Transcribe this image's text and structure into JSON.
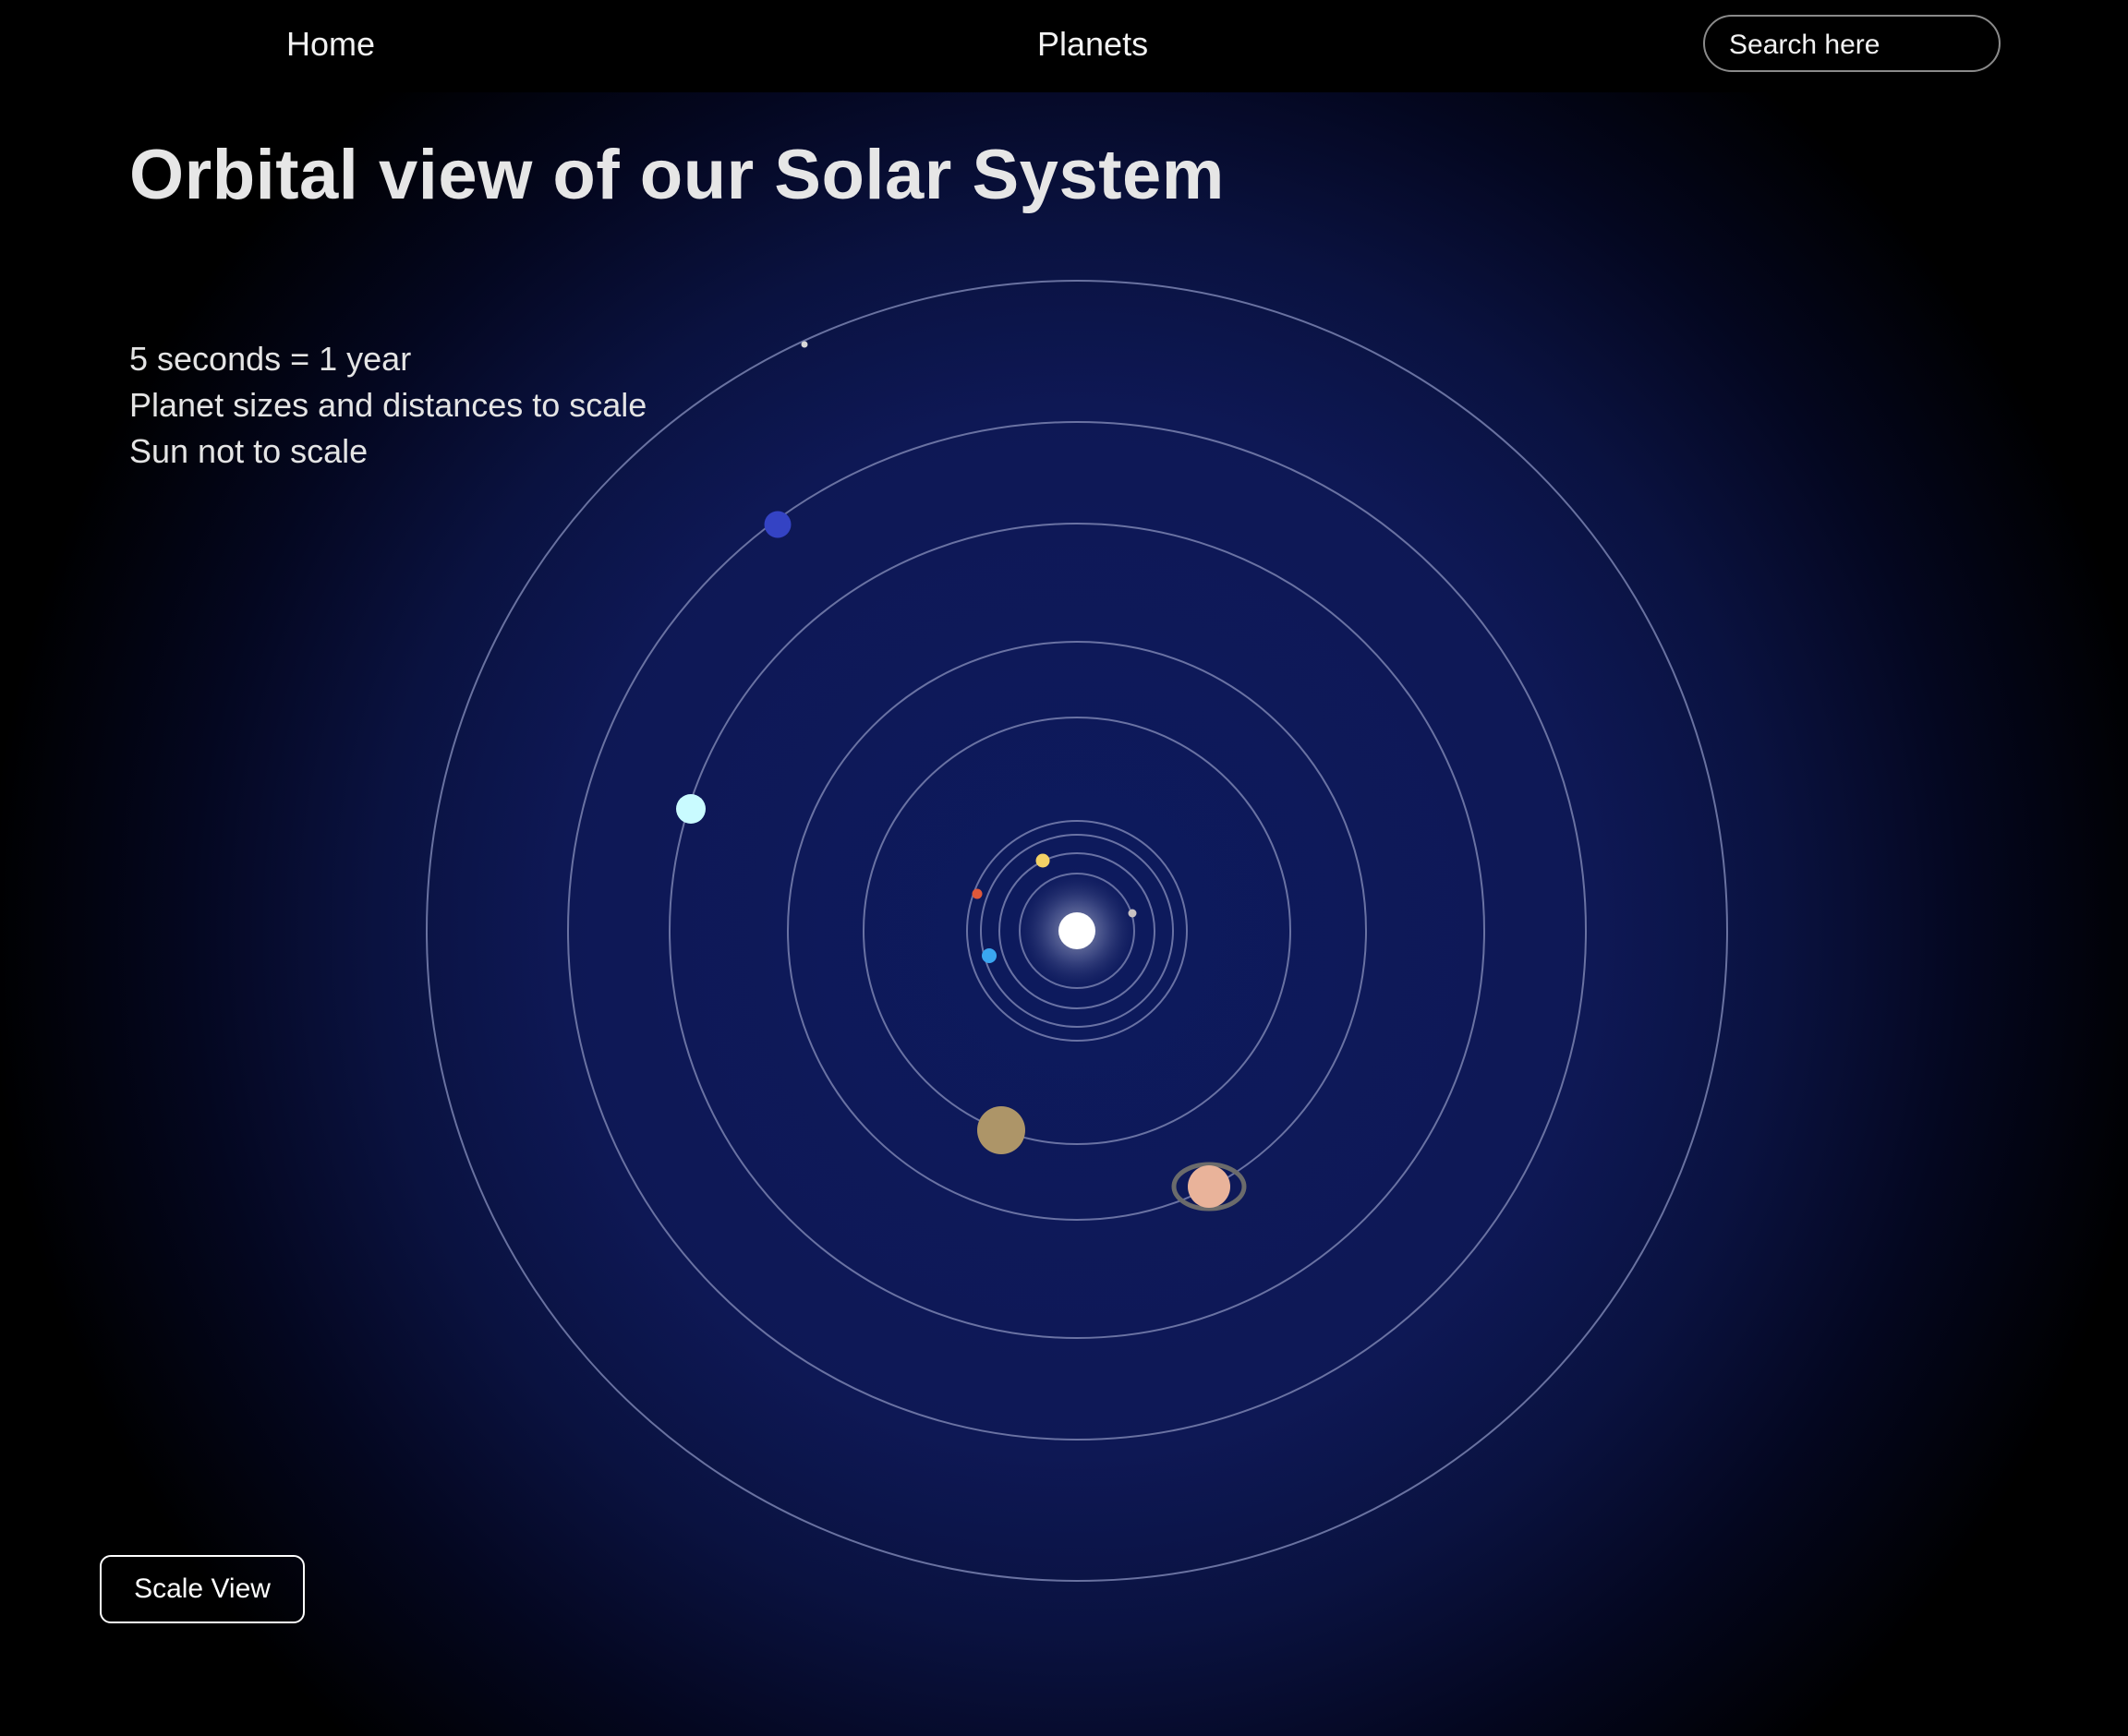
{
  "nav": {
    "home_label": "Home",
    "planets_label": "Planets",
    "search_placeholder": "Search here"
  },
  "page": {
    "title": "Orbital view of our Solar System",
    "notes": [
      "5 seconds = 1 year",
      "Planet sizes and distances to scale",
      "Sun not to scale"
    ]
  },
  "colors": {
    "background": "#000000",
    "space_glow": "#0d1a5e",
    "orbit_line": "#7a82b0",
    "sun": "#ffffff"
  },
  "bodies": {
    "sun": {
      "name": "sun",
      "color": "#ffffff"
    },
    "planets": [
      {
        "name": "mercury",
        "color": "#c9c2c2"
      },
      {
        "name": "venus",
        "color": "#f3d266"
      },
      {
        "name": "earth",
        "color": "#3aa6f0"
      },
      {
        "name": "mars",
        "color": "#e0583a"
      },
      {
        "name": "jupiter",
        "color": "#ad9568"
      },
      {
        "name": "saturn",
        "color": "#e9b39a",
        "ring_color": "#6b6b6b"
      },
      {
        "name": "uranus",
        "color": "#c9fbff"
      },
      {
        "name": "neptune",
        "color": "#3443c4"
      },
      {
        "name": "pluto",
        "color": "#d8d8d8"
      }
    ]
  },
  "controls": {
    "scale_view_label": "Scale View"
  }
}
